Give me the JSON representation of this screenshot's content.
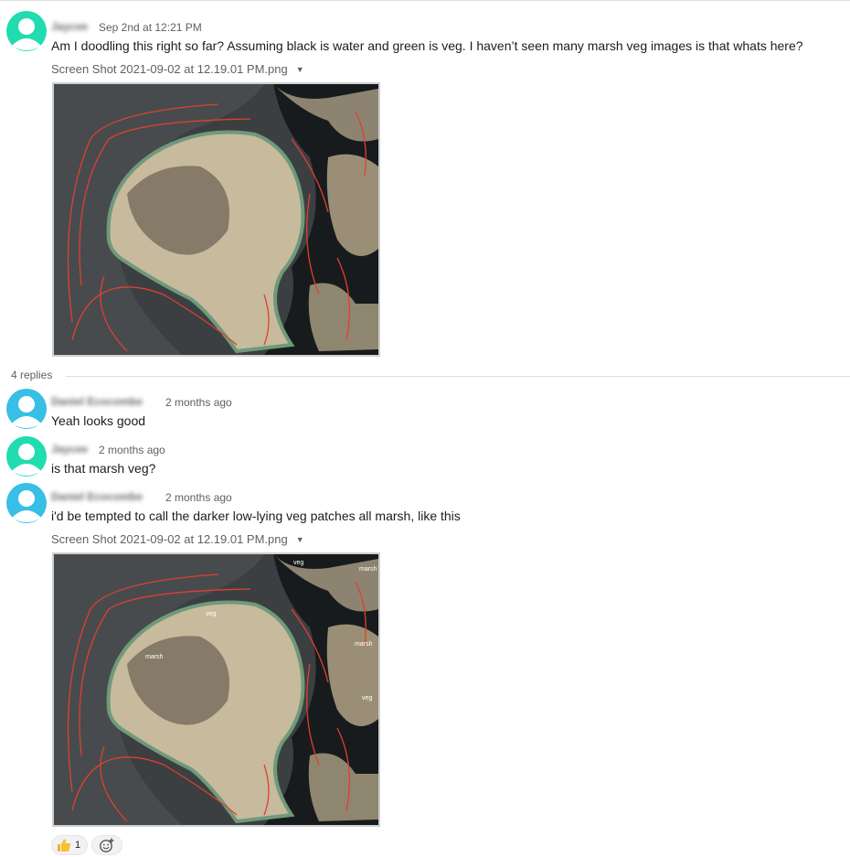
{
  "messages": [
    {
      "author": "Jaycee",
      "time": "Sep 2nd at 12:21 PM",
      "text": "Am I doodling this right so far? Assuming black is water and green is veg. I haven’t seen many marsh veg images is that whats here?",
      "attachment": "Screen Shot 2021-09-02 at 12.19.01 PM.png"
    }
  ],
  "thread": {
    "replies_label": "4 replies",
    "replies": [
      {
        "author": "Daniel Ecocombe",
        "time": "2 months ago",
        "text": "Yeah looks good"
      },
      {
        "author": "Jaycee",
        "time": "2 months ago",
        "text": "is that marsh veg?"
      },
      {
        "author": "Daniel Ecocombe",
        "time": "2 months ago",
        "text": "i'd be tempted to call the darker low-lying veg patches all marsh, like this",
        "attachment": "Screen Shot 2021-09-02 at 12.19.01 PM.png",
        "image_labels": [
          "veg",
          "marsh",
          "veg",
          "marsh",
          "marsh",
          "veg"
        ]
      }
    ]
  },
  "reactions": {
    "thumbs_up_count": "1"
  },
  "colors": {
    "avatar_green": "#20dcae",
    "avatar_blue": "#37bfe6",
    "doodle_red": "#e0402f"
  },
  "icons": [
    "user-avatar-icon",
    "caret-down-icon",
    "thumbs-up-icon",
    "add-reaction-icon"
  ]
}
